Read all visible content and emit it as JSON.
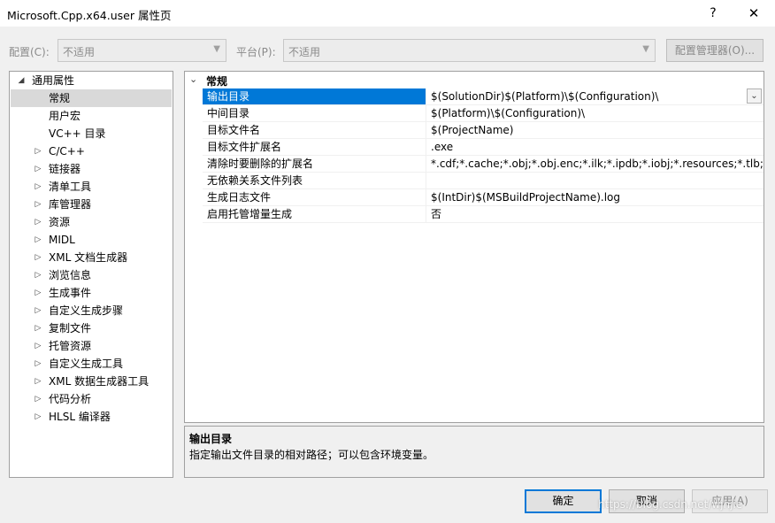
{
  "window": {
    "title": "Microsoft.Cpp.x64.user 属性页",
    "help_label": "?",
    "close_label": "✕"
  },
  "config": {
    "config_label": "配置(C):",
    "config_value": "不适用",
    "platform_label": "平台(P):",
    "platform_value": "不适用",
    "manager_label": "配置管理器(O)..."
  },
  "tree": {
    "items": [
      {
        "label": "通用属性",
        "expander": "◢",
        "level": 0,
        "state": "expanded"
      },
      {
        "label": "常规",
        "expander": "",
        "level": 1,
        "state": "selected"
      },
      {
        "label": "用户宏",
        "expander": "",
        "level": 1,
        "state": ""
      },
      {
        "label": "VC++ 目录",
        "expander": "",
        "level": 1,
        "state": ""
      },
      {
        "label": "C/C++",
        "expander": "▷",
        "level": 1,
        "state": ""
      },
      {
        "label": "链接器",
        "expander": "▷",
        "level": 1,
        "state": ""
      },
      {
        "label": "清单工具",
        "expander": "▷",
        "level": 1,
        "state": ""
      },
      {
        "label": "库管理器",
        "expander": "▷",
        "level": 1,
        "state": ""
      },
      {
        "label": "资源",
        "expander": "▷",
        "level": 1,
        "state": ""
      },
      {
        "label": "MIDL",
        "expander": "▷",
        "level": 1,
        "state": ""
      },
      {
        "label": "XML 文档生成器",
        "expander": "▷",
        "level": 1,
        "state": ""
      },
      {
        "label": "浏览信息",
        "expander": "▷",
        "level": 1,
        "state": ""
      },
      {
        "label": "生成事件",
        "expander": "▷",
        "level": 1,
        "state": ""
      },
      {
        "label": "自定义生成步骤",
        "expander": "▷",
        "level": 1,
        "state": ""
      },
      {
        "label": "复制文件",
        "expander": "▷",
        "level": 1,
        "state": ""
      },
      {
        "label": "托管资源",
        "expander": "▷",
        "level": 1,
        "state": ""
      },
      {
        "label": "自定义生成工具",
        "expander": "▷",
        "level": 1,
        "state": ""
      },
      {
        "label": "XML 数据生成器工具",
        "expander": "▷",
        "level": 1,
        "state": ""
      },
      {
        "label": "代码分析",
        "expander": "▷",
        "level": 1,
        "state": ""
      },
      {
        "label": "HLSL 编译器",
        "expander": "▷",
        "level": 1,
        "state": ""
      }
    ]
  },
  "grid": {
    "category": "常规",
    "category_chevron": "⌄",
    "dropdown_glyph": "⌄",
    "rows": [
      {
        "name": "输出目录",
        "value": "$(SolutionDir)$(Platform)\\$(Configuration)\\"
      },
      {
        "name": "中间目录",
        "value": "$(Platform)\\$(Configuration)\\"
      },
      {
        "name": "目标文件名",
        "value": "$(ProjectName)"
      },
      {
        "name": "目标文件扩展名",
        "value": ".exe"
      },
      {
        "name": "清除时要删除的扩展名",
        "value": "*.cdf;*.cache;*.obj;*.obj.enc;*.ilk;*.ipdb;*.iobj;*.resources;*.tlb;*.tli;*.t"
      },
      {
        "name": "无依赖关系文件列表",
        "value": ""
      },
      {
        "name": "生成日志文件",
        "value": "$(IntDir)$(MSBuildProjectName).log"
      },
      {
        "name": "启用托管增量生成",
        "value": "否"
      }
    ]
  },
  "description": {
    "title": "输出目录",
    "text": "指定输出文件目录的相对路径；可以包含环境变量。"
  },
  "buttons": {
    "ok": "确定",
    "cancel": "取消",
    "apply": "应用(A)"
  },
  "watermark": "https://blog.csdn.net/wjhjie",
  "colors": {
    "selection": "#0078d7",
    "tree_selection": "#cce8ff"
  }
}
